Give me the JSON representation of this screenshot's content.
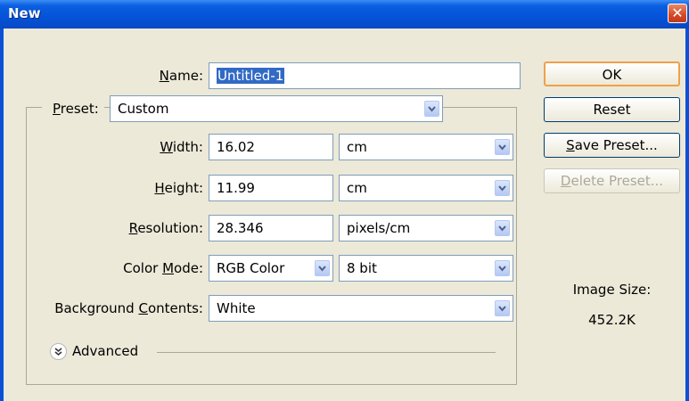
{
  "dialog": {
    "title": "New",
    "close_glyph": "✕"
  },
  "name": {
    "label_underline": "N",
    "label_rest": "ame:",
    "value": "Untitled-1"
  },
  "preset": {
    "label_underline": "P",
    "label_rest": "reset:",
    "value": "Custom"
  },
  "width": {
    "label_pre": "",
    "label_underline": "W",
    "label_rest": "idth:",
    "value": "16.02",
    "unit": "cm"
  },
  "height": {
    "label_pre": "",
    "label_underline": "H",
    "label_rest": "eight:",
    "value": "11.99",
    "unit": "cm"
  },
  "resolution": {
    "label_pre": "",
    "label_underline": "R",
    "label_rest": "esolution:",
    "value": "28.346",
    "unit": "pixels/cm"
  },
  "color_mode": {
    "label_pre": "Color ",
    "label_underline": "M",
    "label_rest": "ode:",
    "value": "RGB Color",
    "depth": "8 bit"
  },
  "background": {
    "label_pre": "Background ",
    "label_underline": "C",
    "label_rest": "ontents:",
    "value": "White"
  },
  "advanced": {
    "label": "Advanced",
    "icon": "expand-chevrons-icon"
  },
  "buttons": {
    "ok": "OK",
    "reset": "Reset",
    "save_underline": "S",
    "save_rest": "ave Preset...",
    "delete_underline": "D",
    "delete_rest": "elete Preset..."
  },
  "image_size": {
    "label": "Image Size:",
    "value": "452.2K"
  },
  "colors": {
    "titlebar": "#0553d8",
    "dialog_bg": "#ece9d8",
    "selection": "#316ac5",
    "default_button_border": "#f0a04a"
  }
}
